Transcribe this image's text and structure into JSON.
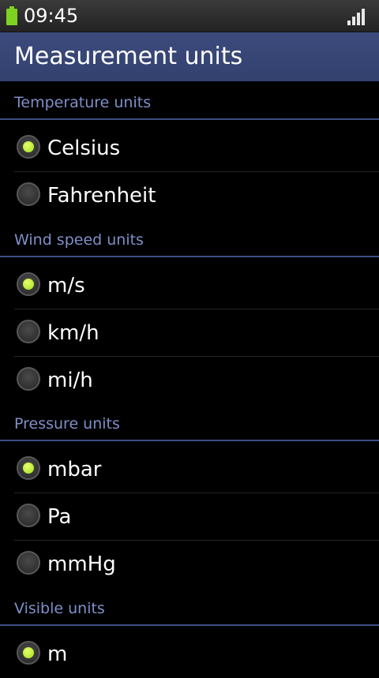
{
  "status_bar": {
    "time": "09:45"
  },
  "title": "Measurement units",
  "sections": [
    {
      "header": "Temperature units",
      "options": [
        {
          "label": "Celsius",
          "selected": true
        },
        {
          "label": "Fahrenheit",
          "selected": false
        }
      ]
    },
    {
      "header": "Wind speed units",
      "options": [
        {
          "label": "m/s",
          "selected": true
        },
        {
          "label": "km/h",
          "selected": false
        },
        {
          "label": "mi/h",
          "selected": false
        }
      ]
    },
    {
      "header": "Pressure units",
      "options": [
        {
          "label": "mbar",
          "selected": true
        },
        {
          "label": "Pa",
          "selected": false
        },
        {
          "label": "mmHg",
          "selected": false
        }
      ]
    },
    {
      "header": "Visible units",
      "options": [
        {
          "label": "m",
          "selected": true
        }
      ]
    }
  ],
  "colors": {
    "accent": "#9fe01a",
    "title_bar": "#33416f",
    "section_text": "#7f8fc8"
  }
}
